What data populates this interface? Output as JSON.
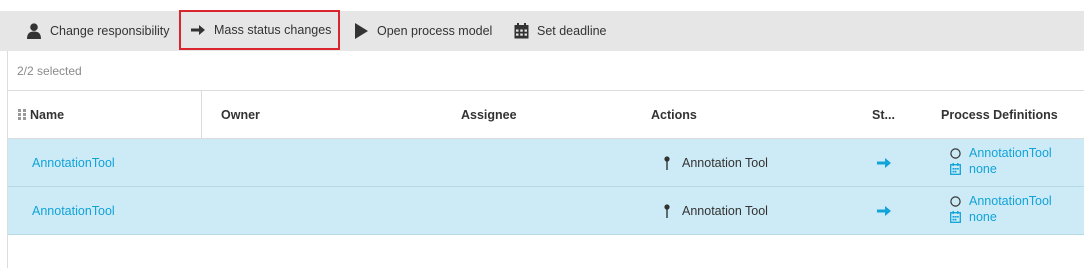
{
  "toolbar": {
    "buttons": [
      {
        "label": "Change responsibility",
        "icon": "person-icon"
      },
      {
        "label": "Mass status changes",
        "icon": "arrow-right-icon"
      },
      {
        "label": "Open process model",
        "icon": "play-icon"
      },
      {
        "label": "Set deadline",
        "icon": "calendar-icon"
      }
    ],
    "active_button": "Mass status changes"
  },
  "selection": {
    "count_text": "2/2 selected"
  },
  "table": {
    "columns": [
      "Name",
      "Owner",
      "Assignee",
      "Actions",
      "St...",
      "Process Definitions"
    ],
    "rows": [
      {
        "name": "AnnotationTool",
        "owner": "",
        "assignee": "",
        "action": "Annotation Tool",
        "status_icon": "arrow-right-icon",
        "process_definition": "AnnotationTool",
        "deadline": "none"
      },
      {
        "name": "AnnotationTool",
        "owner": "",
        "assignee": "",
        "action": "Annotation Tool",
        "status_icon": "arrow-right-icon",
        "process_definition": "AnnotationTool",
        "deadline": "none"
      }
    ]
  },
  "colors": {
    "accent": "#12a3d8",
    "row_selected": "#cdebf6",
    "toolbar_bg": "#e6e6e6",
    "active_outline": "#d9262e"
  }
}
